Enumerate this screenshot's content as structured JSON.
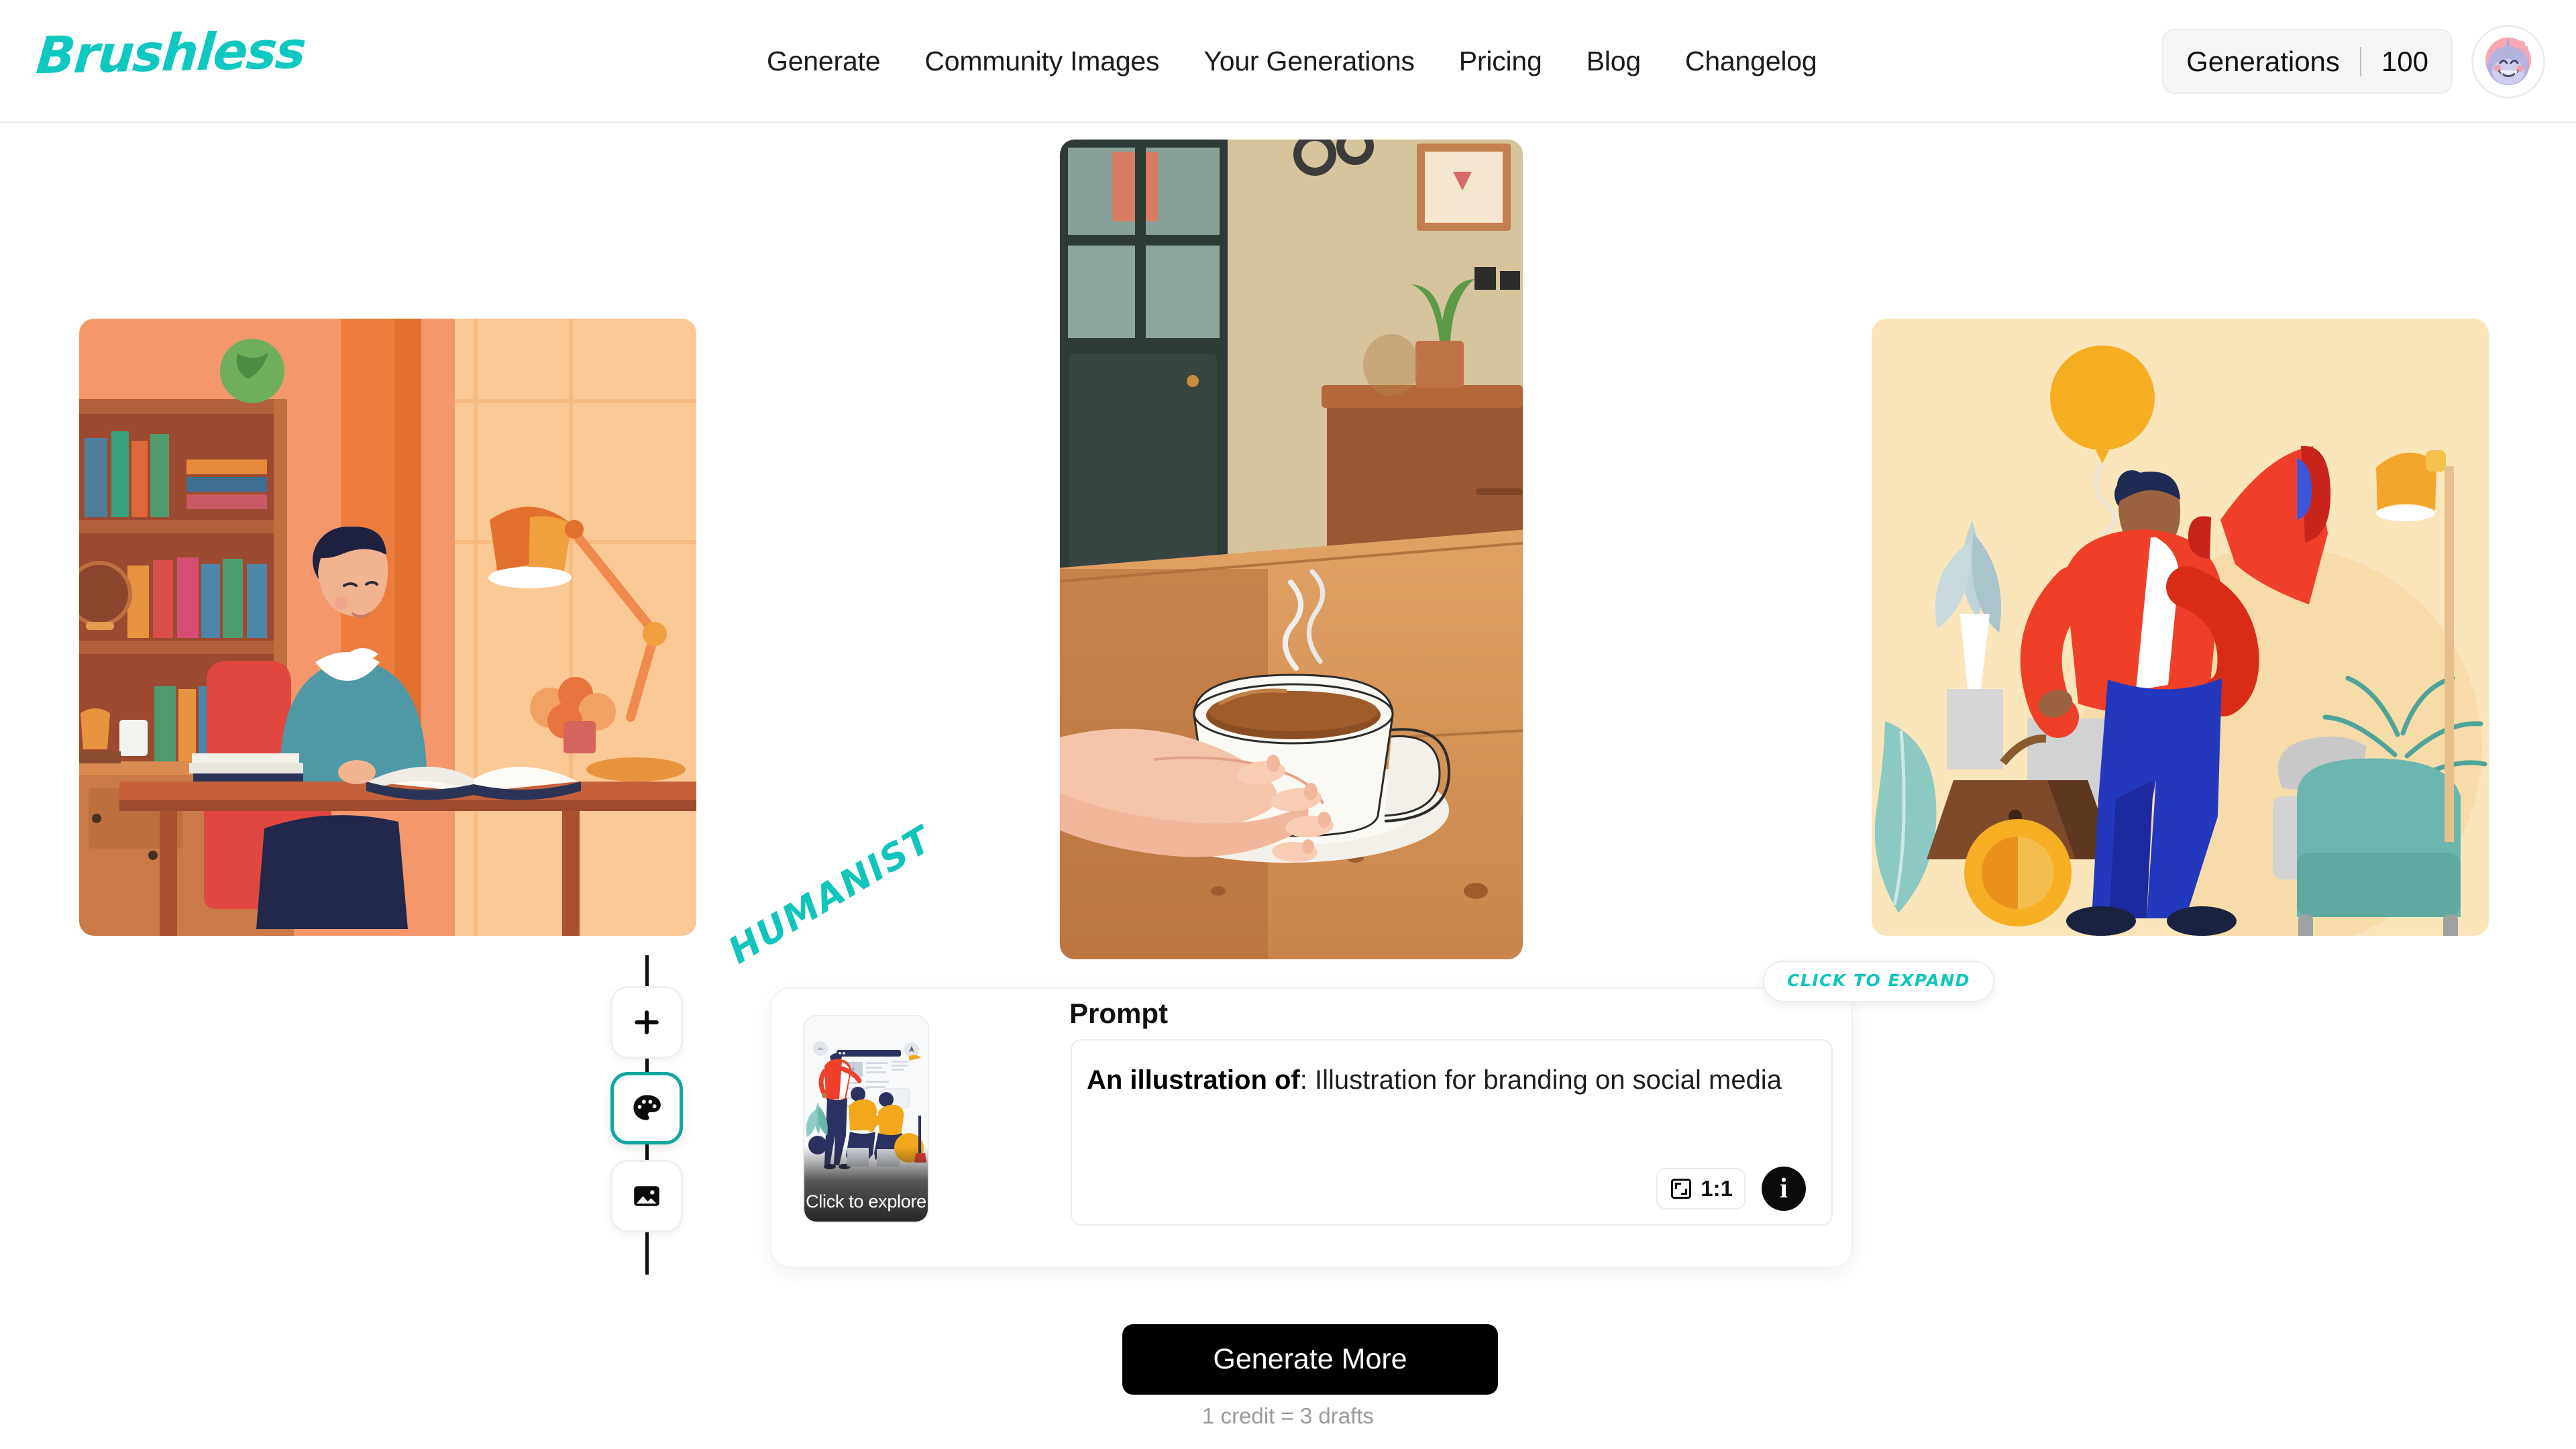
{
  "header": {
    "logo": "Brushless",
    "nav": [
      {
        "label": "Generate"
      },
      {
        "label": "Community Images"
      },
      {
        "label": "Your Generations"
      },
      {
        "label": "Pricing"
      },
      {
        "label": "Blog"
      },
      {
        "label": "Changelog"
      }
    ],
    "generations": {
      "label": "Generations",
      "value": "100"
    },
    "avatar_alt": "shark-avatar"
  },
  "gallery": {
    "images": [
      {
        "alt": "Flat illustration of a woman reading a book at a wooden desk in a warm orange study with a bookshelf, globe, desk lamp and potted flowers",
        "bg": "#F08A4E"
      },
      {
        "alt": "Illustration of two hands cradling a steaming cup of coffee on a saucer on a wooden table, blurred interior behind",
        "bg": "#C98A52"
      },
      {
        "alt": "Flat illustration of a woman in a red jacket holding a megaphone, with a balloon, plants, an armchair and a floor lamp on a cream background",
        "bg": "#FAE7BD"
      }
    ]
  },
  "toolbar": {
    "add_label": "add",
    "style_label": "style",
    "image_label": "reference image",
    "active": "style"
  },
  "prompt_panel": {
    "style_tag": "HUMANIST",
    "style_thumb_cta": "Click to explore",
    "expand_badge": "CLICK TO EXPAND",
    "prompt_label": "Prompt",
    "prompt_prefix": "An illustration of",
    "prompt_separator": ": ",
    "prompt_value": "Illustration for branding on social media",
    "aspect_ratio": "1:1",
    "info_glyph": "i"
  },
  "footer": {
    "generate_more": "Generate More",
    "credit_note": "1 credit = 3 drafts"
  },
  "colors": {
    "brand_teal": "#0FC8C0",
    "active_border": "#0FA79F",
    "cta_bg": "#000000"
  }
}
